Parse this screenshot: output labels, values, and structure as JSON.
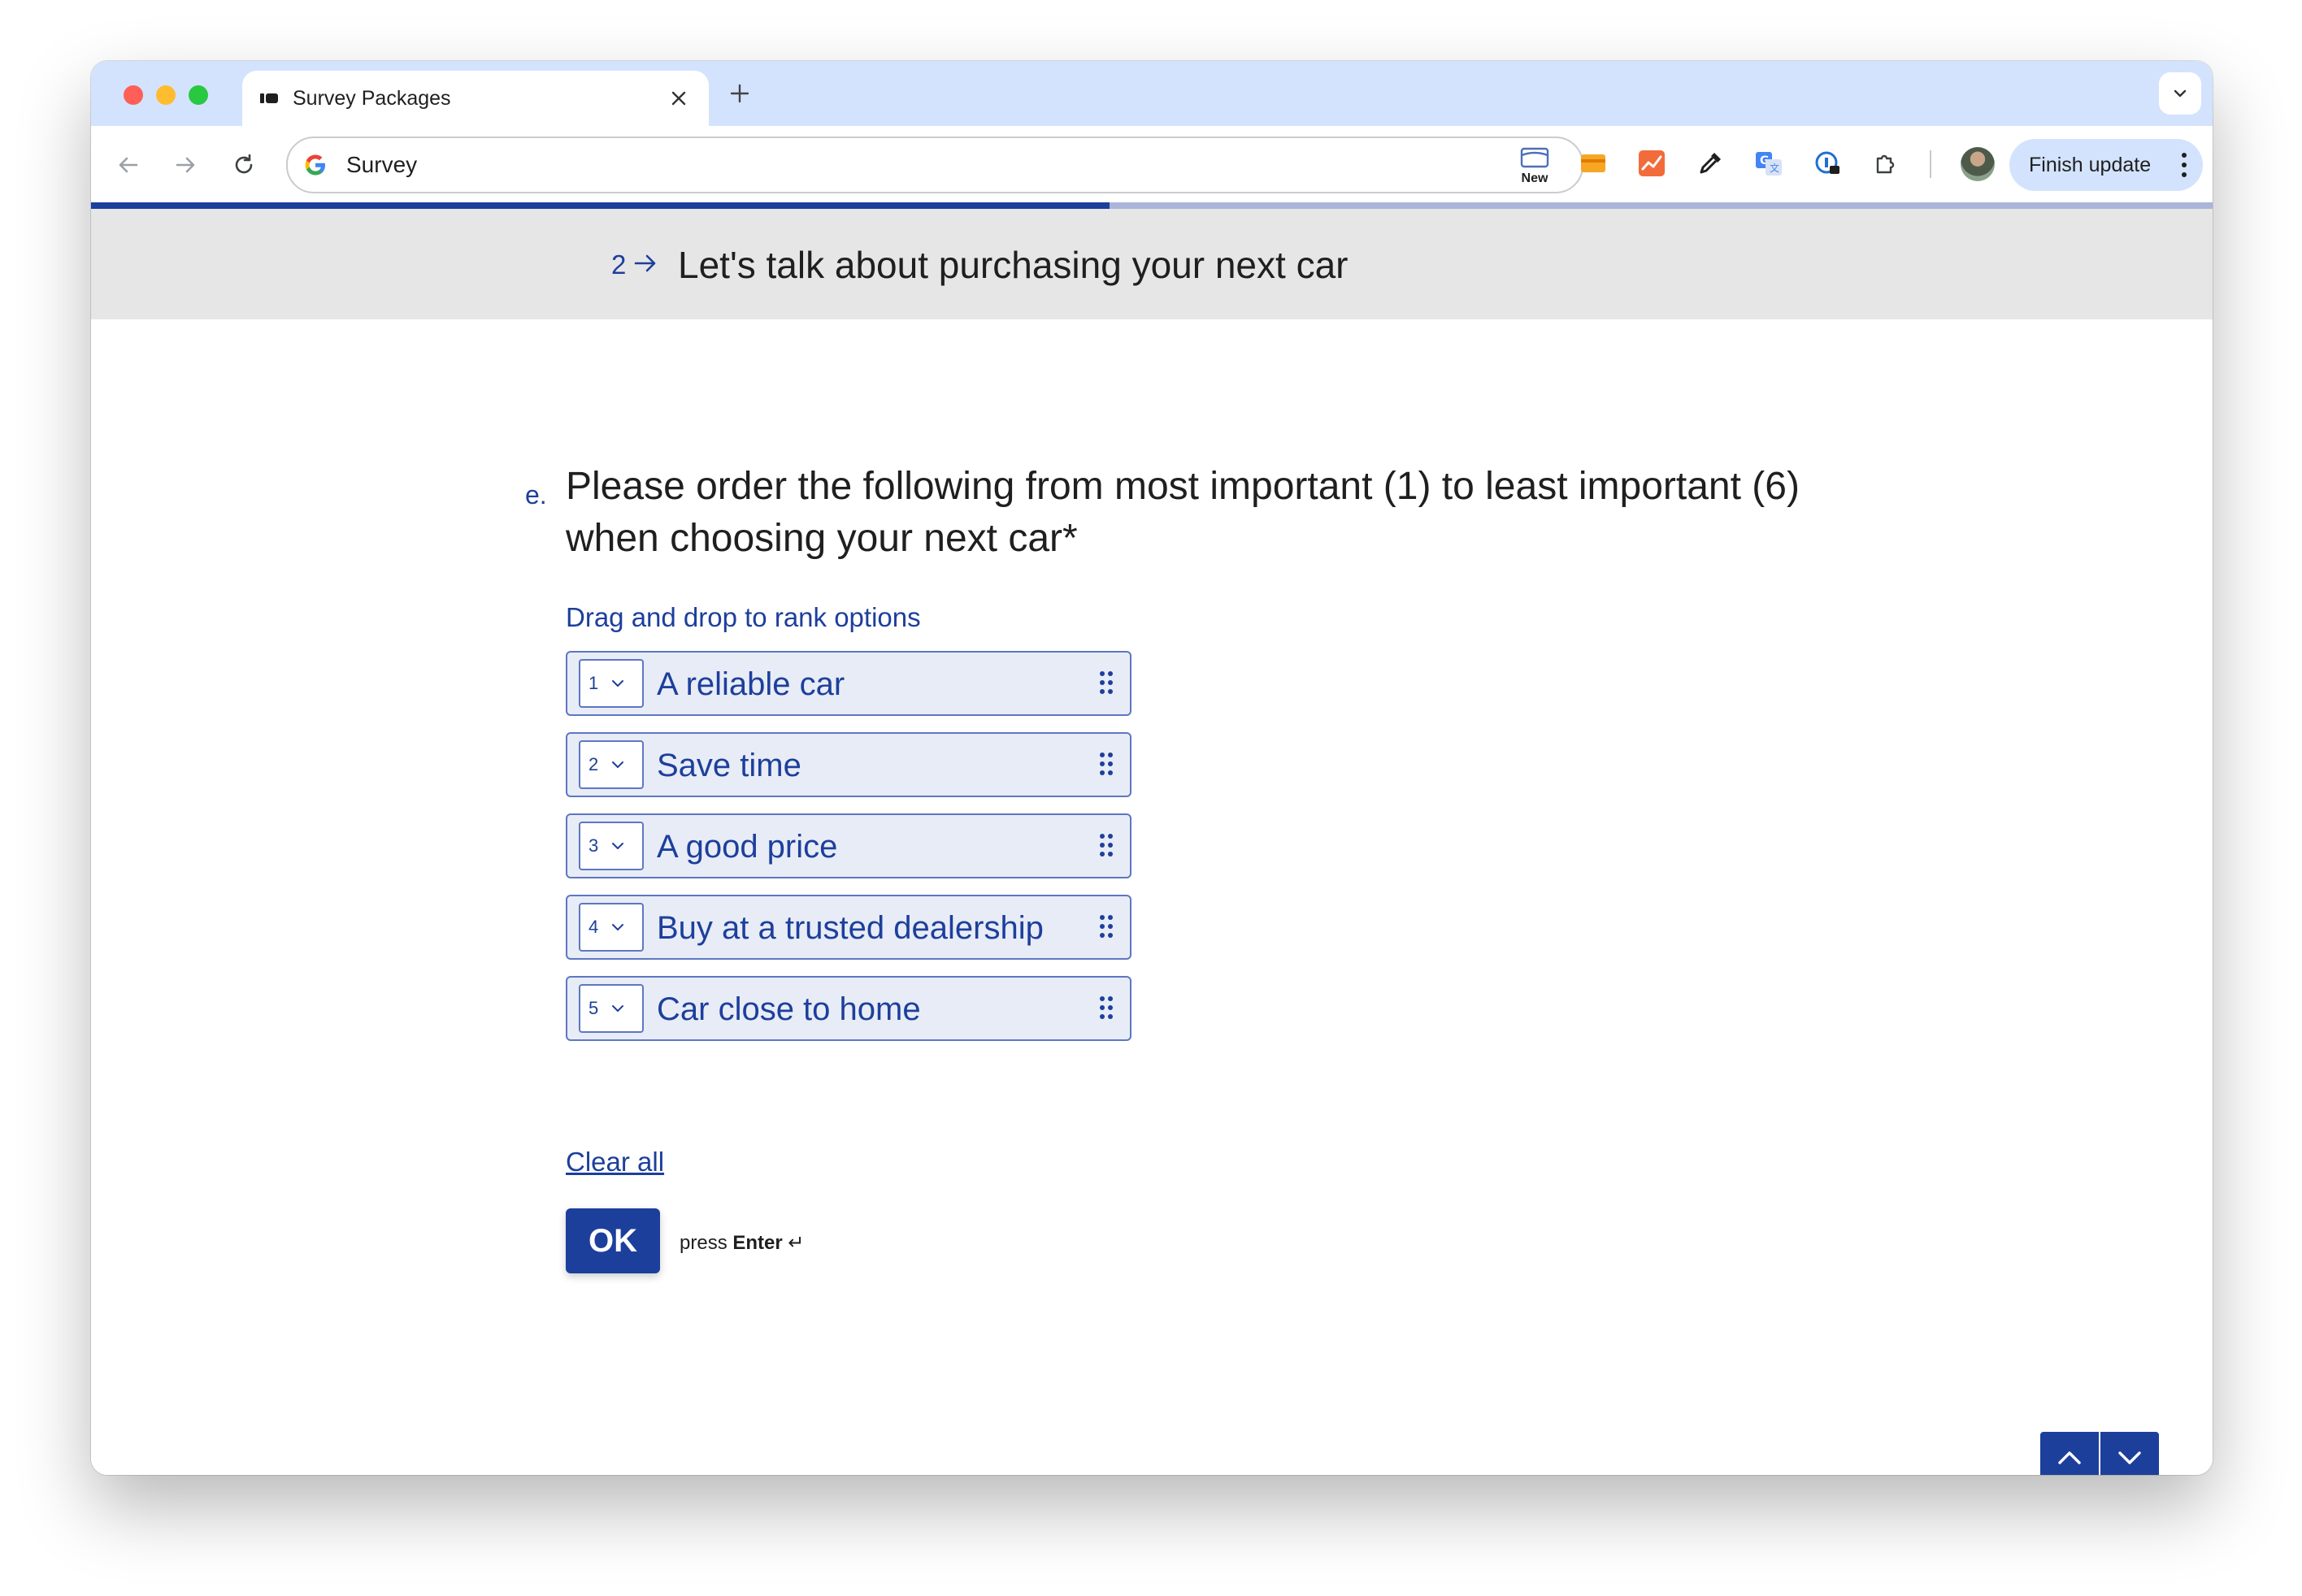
{
  "browser": {
    "tab_title": "Survey Packages",
    "address": "Survey",
    "new_extension_label": "New",
    "finish_update_label": "Finish update"
  },
  "survey": {
    "progress_fraction": 0.48,
    "section_number": "2",
    "section_title": "Let's talk about purchasing your next car",
    "question_letter": "e.",
    "question_text": "Please order the following from most important (1) to least important (6) when choosing your next car*",
    "hint": "Drag and drop to rank options",
    "options": [
      {
        "rank": "1",
        "label": "A reliable car"
      },
      {
        "rank": "2",
        "label": "Save time"
      },
      {
        "rank": "3",
        "label": "A good price"
      },
      {
        "rank": "4",
        "label": "Buy at a trusted dealership"
      },
      {
        "rank": "5",
        "label": "Car close to home"
      }
    ],
    "clear_all": "Clear all",
    "ok_label": "OK",
    "press_label": "press",
    "enter_label": "Enter",
    "enter_symbol": "↵"
  },
  "colors": {
    "accent": "#1d3f9c",
    "option_bg": "#e8ecf6",
    "header_bg": "#e6e6e6",
    "tabstrip_bg": "#d3e3fd"
  }
}
